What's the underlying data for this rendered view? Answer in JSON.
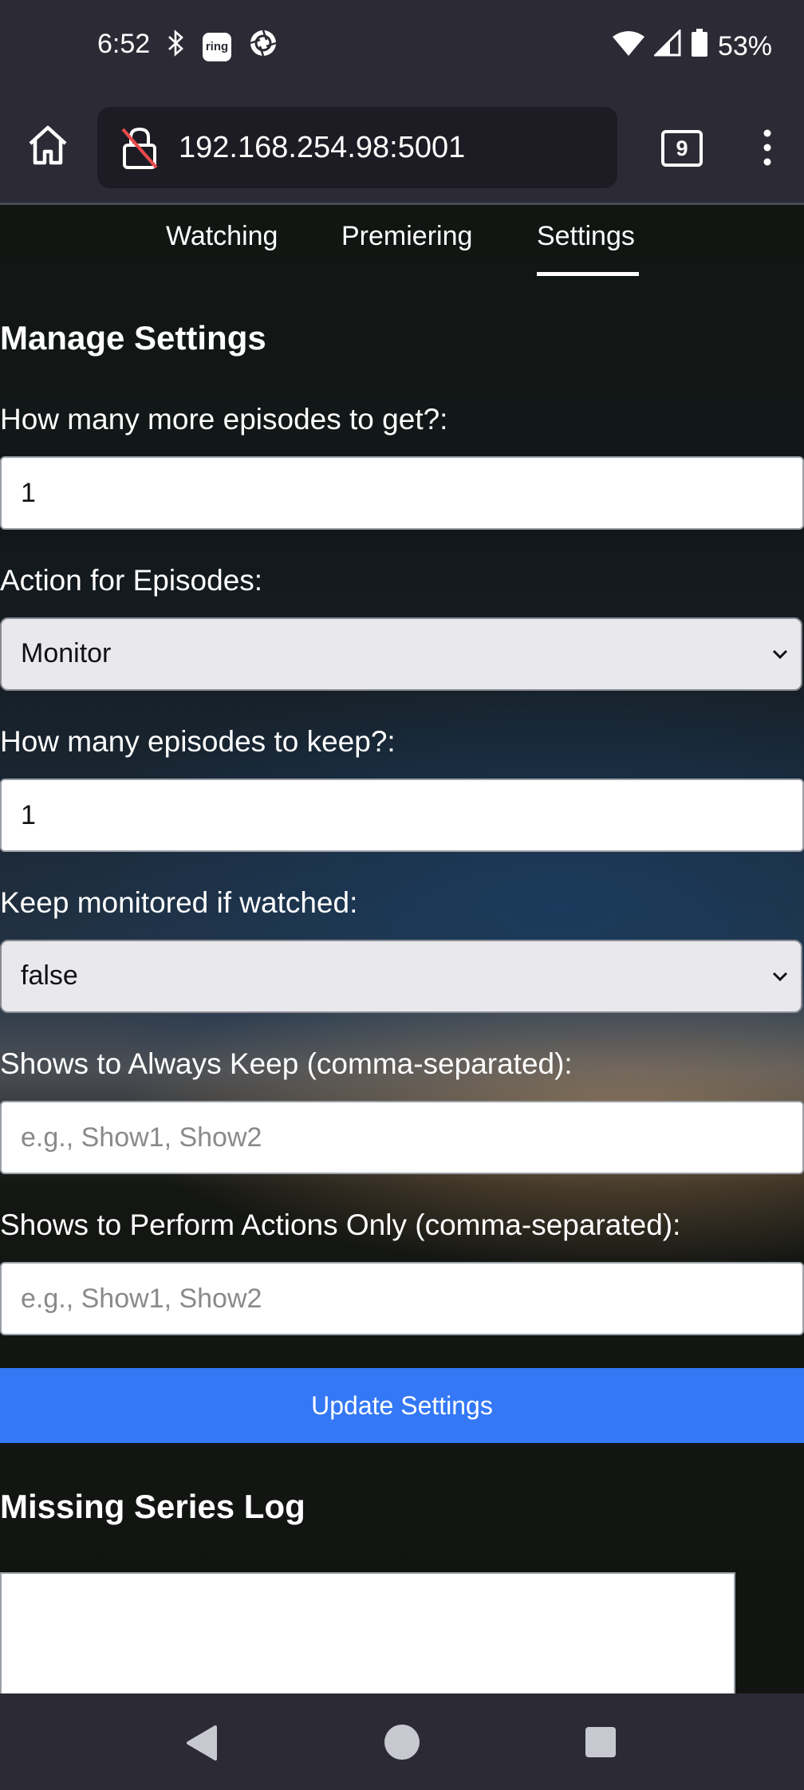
{
  "status_bar": {
    "time": "6:52",
    "battery": "53%",
    "icons": [
      "bluetooth-icon",
      "ring-app-icon",
      "aperture-app-icon",
      "wifi-icon",
      "cell-signal-icon",
      "battery-icon"
    ],
    "ring_label": "ring"
  },
  "browser": {
    "url": "192.168.254.98:5001",
    "tab_count": "9"
  },
  "nav": {
    "tabs": [
      {
        "label": "Watching"
      },
      {
        "label": "Premiering"
      },
      {
        "label": "Settings",
        "active": true
      }
    ]
  },
  "settings": {
    "title": "Manage Settings",
    "episodes_to_get": {
      "label": "How many more episodes to get?:",
      "value": "1"
    },
    "action_for_episodes": {
      "label": "Action for Episodes:",
      "value": "Monitor"
    },
    "episodes_to_keep": {
      "label": "How many episodes to keep?:",
      "value": "1"
    },
    "keep_monitored": {
      "label": "Keep monitored if watched:",
      "value": "false"
    },
    "always_keep": {
      "label": "Shows to Always Keep (comma-separated):",
      "placeholder": "e.g., Show1, Show2"
    },
    "actions_only": {
      "label": "Shows to Perform Actions Only (comma-separated):",
      "placeholder": "e.g., Show1, Show2"
    },
    "update_button": "Update Settings"
  },
  "log": {
    "title": "Missing Series Log"
  },
  "colors": {
    "accent": "#3478f6",
    "chrome": "#2c2b35",
    "page_bg": "#14161a"
  }
}
